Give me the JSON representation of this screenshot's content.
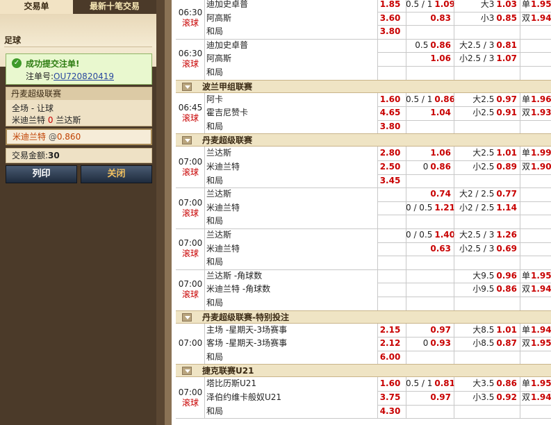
{
  "left": {
    "tabs": [
      "交易单",
      "最新十笔交易"
    ],
    "sport": "足球",
    "success_msg": "成功提交注单!",
    "order_label": "注单号:",
    "order_no": "OU720820419",
    "league": "丹麦超级联赛",
    "market": "全场 - 让球",
    "selection_team": "米迪兰特",
    "selection_score": "0",
    "selection_opp": "兰达斯",
    "pick_team": "米迪兰特",
    "pick_at": "@",
    "pick_odds": "0.860",
    "amount_label": "交易金额:",
    "amount": "30",
    "print": "列印",
    "close": "关闭"
  },
  "leagues": [
    {
      "name": "波兰甲组联赛"
    },
    {
      "name": "丹麦超级联赛"
    },
    {
      "name": "丹麦超级联赛-特别投注"
    },
    {
      "name": "捷克联赛U21"
    }
  ],
  "matches": [
    {
      "time": "06:30",
      "live": "滚球",
      "teams": [
        "迪加史卓普",
        "阿高斯",
        "和局"
      ],
      "m1": [
        "1.85",
        "3.60",
        "3.80"
      ],
      "hcap": [
        [
          "0.5 / 1",
          "1.09"
        ],
        [
          "",
          "0.83"
        ],
        [
          "",
          ""
        ]
      ],
      "ou": [
        [
          "大3",
          "1.03"
        ],
        [
          "小3",
          "0.85"
        ],
        [
          "",
          ""
        ]
      ],
      "oe": [
        [
          "单",
          "1.95"
        ],
        [
          "双",
          "1.94"
        ],
        [
          "",
          ""
        ]
      ]
    },
    {
      "time": "06:30",
      "live": "滚球",
      "teams": [
        "迪加史卓普",
        "阿高斯",
        "和局"
      ],
      "m1": [
        "",
        "",
        ""
      ],
      "hcap": [
        [
          "0.5",
          "0.86"
        ],
        [
          "",
          "1.06"
        ],
        [
          "",
          ""
        ]
      ],
      "ou": [
        [
          "大2.5 / 3",
          "0.81"
        ],
        [
          "小2.5 / 3",
          "1.07"
        ],
        [
          "",
          ""
        ]
      ],
      "oe": [
        [
          "",
          ""
        ],
        [
          "",
          ""
        ],
        [
          "",
          ""
        ]
      ]
    },
    {
      "time": "06:45",
      "live": "滚球",
      "teams": [
        "阿卡",
        "霍吉尼赞卡",
        "和局"
      ],
      "m1": [
        "1.60",
        "4.65",
        "3.80"
      ],
      "hcap": [
        [
          "0.5 / 1",
          "0.86"
        ],
        [
          "",
          "1.04"
        ],
        [
          "",
          ""
        ]
      ],
      "ou": [
        [
          "大2.5",
          "0.97"
        ],
        [
          "小2.5",
          "0.91"
        ],
        [
          "",
          ""
        ]
      ],
      "oe": [
        [
          "单",
          "1.96"
        ],
        [
          "双",
          "1.93"
        ],
        [
          "",
          ""
        ]
      ]
    },
    {
      "time": "07:00",
      "live": "滚球",
      "teams": [
        "兰达斯",
        "米迪兰特",
        "和局"
      ],
      "m1": [
        "2.80",
        "2.50",
        "3.45"
      ],
      "hcap": [
        [
          "",
          "1.06"
        ],
        [
          "0",
          "0.86"
        ],
        [
          "",
          ""
        ]
      ],
      "ou": [
        [
          "大2.5",
          "1.01"
        ],
        [
          "小2.5",
          "0.89"
        ],
        [
          "",
          ""
        ]
      ],
      "oe": [
        [
          "单",
          "1.99"
        ],
        [
          "双",
          "1.90"
        ],
        [
          "",
          ""
        ]
      ]
    },
    {
      "time": "07:00",
      "live": "滚球",
      "teams": [
        "兰达斯",
        "米迪兰特",
        "和局"
      ],
      "m1": [
        "",
        "",
        ""
      ],
      "hcap": [
        [
          "",
          "0.74"
        ],
        [
          "0 / 0.5",
          "1.21"
        ],
        [
          "",
          ""
        ]
      ],
      "ou": [
        [
          "大2 / 2.5",
          "0.77"
        ],
        [
          "小2 / 2.5",
          "1.14"
        ],
        [
          "",
          ""
        ]
      ],
      "oe": [
        [
          "",
          ""
        ],
        [
          "",
          ""
        ],
        [
          "",
          ""
        ]
      ]
    },
    {
      "time": "07:00",
      "live": "滚球",
      "teams": [
        "兰达斯",
        "米迪兰特",
        "和局"
      ],
      "m1": [
        "",
        "",
        ""
      ],
      "hcap": [
        [
          "0 / 0.5",
          "1.40"
        ],
        [
          "",
          "0.63"
        ],
        [
          "",
          ""
        ]
      ],
      "ou": [
        [
          "大2.5 / 3",
          "1.26"
        ],
        [
          "小2.5 / 3",
          "0.69"
        ],
        [
          "",
          ""
        ]
      ],
      "oe": [
        [
          "",
          ""
        ],
        [
          "",
          ""
        ],
        [
          "",
          ""
        ]
      ]
    },
    {
      "time": "07:00",
      "live": "滚球",
      "teams": [
        "兰达斯 -角球数",
        "米迪兰特 -角球数",
        "和局"
      ],
      "m1": [
        "",
        "",
        ""
      ],
      "hcap": [
        [
          "",
          ""
        ],
        [
          "",
          ""
        ],
        [
          "",
          ""
        ]
      ],
      "ou": [
        [
          "大9.5",
          "0.96"
        ],
        [
          "小9.5",
          "0.86"
        ],
        [
          "",
          ""
        ]
      ],
      "oe": [
        [
          "单",
          "1.95"
        ],
        [
          "双",
          "1.94"
        ],
        [
          "",
          ""
        ]
      ]
    },
    {
      "time": "07:00",
      "live": "",
      "teams": [
        "主场 -星期天-3场赛事",
        "客场 -星期天-3场赛事",
        "和局"
      ],
      "m1": [
        "2.15",
        "2.12",
        "6.00"
      ],
      "hcap": [
        [
          "",
          "0.97"
        ],
        [
          "0",
          "0.93"
        ],
        [
          "",
          ""
        ]
      ],
      "ou": [
        [
          "大8.5",
          "1.01"
        ],
        [
          "小8.5",
          "0.87"
        ],
        [
          "",
          ""
        ]
      ],
      "oe": [
        [
          "单",
          "1.94"
        ],
        [
          "双",
          "1.95"
        ],
        [
          "",
          ""
        ]
      ]
    },
    {
      "time": "07:00",
      "live": "滚球",
      "teams": [
        "塔比历斯U21",
        "泽伯约维卡般奴U21",
        "和局"
      ],
      "m1": [
        "1.60",
        "3.75",
        "4.30"
      ],
      "hcap": [
        [
          "0.5 / 1",
          "0.81"
        ],
        [
          "",
          "0.97"
        ],
        [
          "",
          ""
        ]
      ],
      "ou": [
        [
          "大3.5",
          "0.86"
        ],
        [
          "小3.5",
          "0.92"
        ],
        [
          "",
          ""
        ]
      ],
      "oe": [
        [
          "单",
          "1.95"
        ],
        [
          "双",
          "1.94"
        ],
        [
          "",
          ""
        ]
      ]
    }
  ]
}
